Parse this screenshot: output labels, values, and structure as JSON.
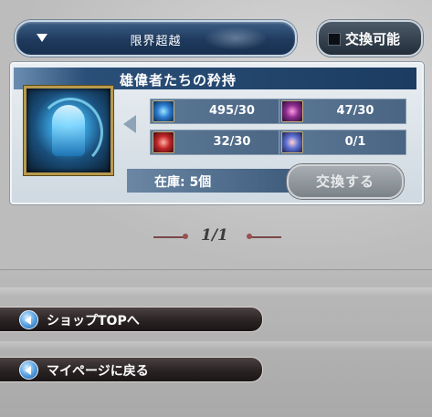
{
  "header": {
    "dropdown_label": "限界超越",
    "toggle_label": "交換可能"
  },
  "item": {
    "title": "雄偉者たちの矜持",
    "image_icon": "blue-cloak-icon",
    "stock_label": "在庫: 5個",
    "exchange_button": "交換する",
    "materials": [
      {
        "icon": "blue-orb-icon",
        "count": "495/30"
      },
      {
        "icon": "purple-blade-icon",
        "count": "47/30"
      },
      {
        "icon": "red-sigil-icon",
        "count": "32/30"
      },
      {
        "icon": "crystal-cube-icon",
        "count": "0/1"
      }
    ]
  },
  "pager": {
    "text": "1/1"
  },
  "nav": {
    "shop_top": "ショップTOPへ",
    "my_page": "マイページに戻る"
  },
  "colors": {
    "accent_blue": "#1f3a5d",
    "card_title_bar": "#1c3c61",
    "gold_frame": "#b99a4d",
    "nav_dark": "#2a2324"
  }
}
